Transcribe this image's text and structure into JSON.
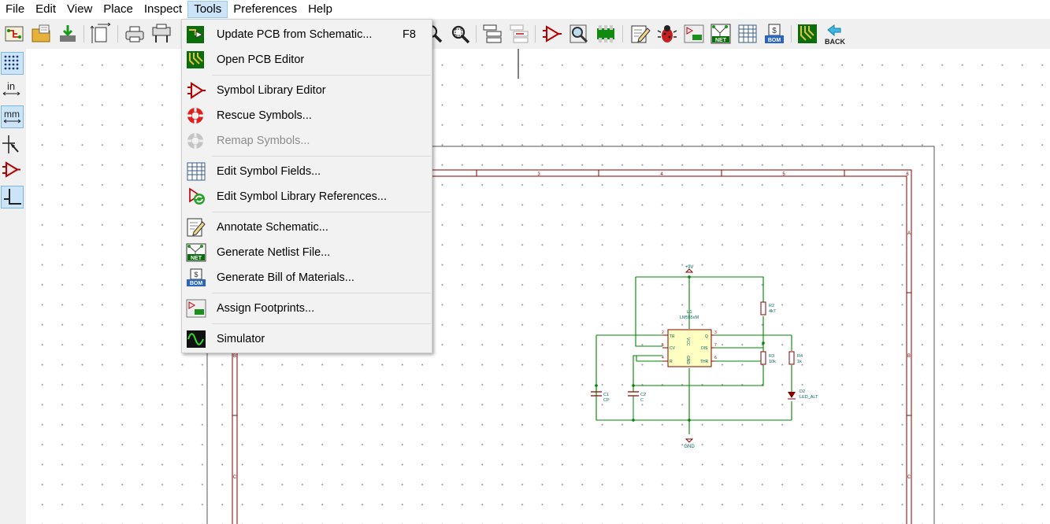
{
  "menubar": {
    "items": [
      {
        "label": "File"
      },
      {
        "label": "Edit"
      },
      {
        "label": "View"
      },
      {
        "label": "Place"
      },
      {
        "label": "Inspect"
      },
      {
        "label": "Tools"
      },
      {
        "label": "Preferences"
      },
      {
        "label": "Help"
      }
    ],
    "active": "Tools"
  },
  "toolbar": {
    "back_label": "BACK"
  },
  "left_toolbar": {
    "units_in": "in",
    "units_mm": "mm"
  },
  "tools_menu": {
    "items": [
      {
        "label": "Update PCB from Schematic...",
        "shortcut": "F8",
        "icon": "update-pcb-icon",
        "enabled": true
      },
      {
        "label": "Open PCB Editor",
        "icon": "pcb-editor-icon",
        "enabled": true
      },
      {
        "label": "Symbol Library Editor",
        "icon": "symbol-editor-icon",
        "enabled": true
      },
      {
        "label": "Rescue Symbols...",
        "icon": "rescue-icon",
        "enabled": true
      },
      {
        "label": "Remap Symbols...",
        "icon": "remap-icon",
        "enabled": false
      },
      {
        "label": "Edit Symbol Fields...",
        "icon": "table-icon",
        "enabled": true
      },
      {
        "label": "Edit Symbol Library References...",
        "icon": "edit-lib-refs-icon",
        "enabled": true
      },
      {
        "label": "Annotate Schematic...",
        "icon": "annotate-icon",
        "enabled": true
      },
      {
        "label": "Generate Netlist File...",
        "icon": "netlist-icon",
        "enabled": true
      },
      {
        "label": "Generate Bill of Materials...",
        "icon": "bom-icon",
        "enabled": true
      },
      {
        "label": "Assign Footprints...",
        "icon": "footprint-icon",
        "enabled": true
      },
      {
        "label": "Simulator",
        "icon": "simulator-icon",
        "enabled": true
      }
    ]
  },
  "sheet": {
    "col_labels": [
      "3",
      "4",
      "5",
      "6"
    ],
    "row_labels": [
      "A",
      "B",
      "C"
    ]
  },
  "schematic": {
    "power_top": "+9V",
    "power_bottom": "GND",
    "u1_ref": "U1",
    "u1_value": "LM555xM",
    "pins": {
      "p2": "2",
      "tr": "TR",
      "p5": "5",
      "cv": "CV",
      "p4": "4",
      "r": "R",
      "p3": "3",
      "q": "Q",
      "p7": "7",
      "dis": "DIS",
      "p6": "6",
      "thr": "THR",
      "vcc": "VCC",
      "gnd_pin": "GND"
    },
    "r2": "R2",
    "r2_val": "4k7",
    "r3": "R3",
    "r3_val": "10k",
    "r4": "R4",
    "r4_val": "1k",
    "c1": "C1",
    "c1_val": "CP",
    "c2": "C2",
    "c2_val": "C",
    "d2": "D2",
    "d2_val": "LED_ALT"
  },
  "colors": {
    "wire": "#008400",
    "component": "#840000",
    "label": "#006464",
    "menu_highlight": "#cce4f7"
  }
}
